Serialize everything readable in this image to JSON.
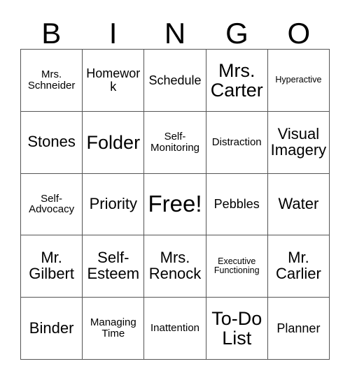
{
  "card": {
    "header_letters": [
      "B",
      "I",
      "N",
      "G",
      "O"
    ],
    "rows": [
      [
        {
          "text": "Mrs. Schneider",
          "size": "s"
        },
        {
          "text": "Homework",
          "size": "m"
        },
        {
          "text": "Schedule",
          "size": "m"
        },
        {
          "text": "Mrs. Carter",
          "size": "xl"
        },
        {
          "text": "Hyperactive",
          "size": "xs"
        }
      ],
      [
        {
          "text": "Stones",
          "size": "l"
        },
        {
          "text": "Folder",
          "size": "xl"
        },
        {
          "text": "Self-Monitoring",
          "size": "s"
        },
        {
          "text": "Distraction",
          "size": "s"
        },
        {
          "text": "Visual Imagery",
          "size": "l"
        }
      ],
      [
        {
          "text": "Self-Advocacy",
          "size": "s"
        },
        {
          "text": "Priority",
          "size": "l"
        },
        {
          "text": "Free!",
          "size": "xxl"
        },
        {
          "text": "Pebbles",
          "size": "m"
        },
        {
          "text": "Water",
          "size": "l"
        }
      ],
      [
        {
          "text": "Mr. Gilbert",
          "size": "l"
        },
        {
          "text": "Self-Esteem",
          "size": "l"
        },
        {
          "text": "Mrs. Renock",
          "size": "l"
        },
        {
          "text": "Executive Functioning",
          "size": "xs"
        },
        {
          "text": "Mr. Carlier",
          "size": "l"
        }
      ],
      [
        {
          "text": "Binder",
          "size": "l"
        },
        {
          "text": "Managing Time",
          "size": "s"
        },
        {
          "text": "Inattention",
          "size": "s"
        },
        {
          "text": "To-Do List",
          "size": "xl"
        },
        {
          "text": "Planner",
          "size": "m"
        }
      ]
    ]
  },
  "colors": {
    "grid_line": "#555555",
    "text": "#000000",
    "background": "#ffffff"
  }
}
